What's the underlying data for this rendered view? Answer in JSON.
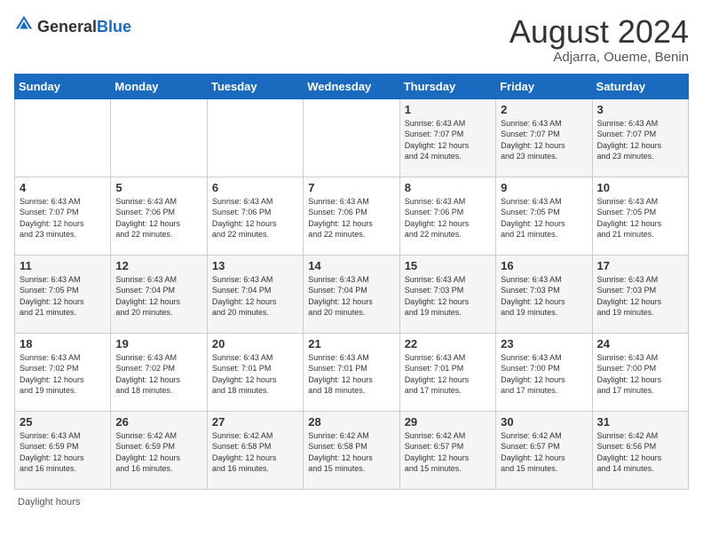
{
  "logo": {
    "text_general": "General",
    "text_blue": "Blue"
  },
  "calendar": {
    "title": "August 2024",
    "subtitle": "Adjarra, Oueme, Benin"
  },
  "days_of_week": [
    "Sunday",
    "Monday",
    "Tuesday",
    "Wednesday",
    "Thursday",
    "Friday",
    "Saturday"
  ],
  "footer": {
    "daylight_label": "Daylight hours"
  },
  "weeks": [
    [
      {
        "day": "",
        "info": ""
      },
      {
        "day": "",
        "info": ""
      },
      {
        "day": "",
        "info": ""
      },
      {
        "day": "",
        "info": ""
      },
      {
        "day": "1",
        "info": "Sunrise: 6:43 AM\nSunset: 7:07 PM\nDaylight: 12 hours\nand 24 minutes."
      },
      {
        "day": "2",
        "info": "Sunrise: 6:43 AM\nSunset: 7:07 PM\nDaylight: 12 hours\nand 23 minutes."
      },
      {
        "day": "3",
        "info": "Sunrise: 6:43 AM\nSunset: 7:07 PM\nDaylight: 12 hours\nand 23 minutes."
      }
    ],
    [
      {
        "day": "4",
        "info": "Sunrise: 6:43 AM\nSunset: 7:07 PM\nDaylight: 12 hours\nand 23 minutes."
      },
      {
        "day": "5",
        "info": "Sunrise: 6:43 AM\nSunset: 7:06 PM\nDaylight: 12 hours\nand 22 minutes."
      },
      {
        "day": "6",
        "info": "Sunrise: 6:43 AM\nSunset: 7:06 PM\nDaylight: 12 hours\nand 22 minutes."
      },
      {
        "day": "7",
        "info": "Sunrise: 6:43 AM\nSunset: 7:06 PM\nDaylight: 12 hours\nand 22 minutes."
      },
      {
        "day": "8",
        "info": "Sunrise: 6:43 AM\nSunset: 7:06 PM\nDaylight: 12 hours\nand 22 minutes."
      },
      {
        "day": "9",
        "info": "Sunrise: 6:43 AM\nSunset: 7:05 PM\nDaylight: 12 hours\nand 21 minutes."
      },
      {
        "day": "10",
        "info": "Sunrise: 6:43 AM\nSunset: 7:05 PM\nDaylight: 12 hours\nand 21 minutes."
      }
    ],
    [
      {
        "day": "11",
        "info": "Sunrise: 6:43 AM\nSunset: 7:05 PM\nDaylight: 12 hours\nand 21 minutes."
      },
      {
        "day": "12",
        "info": "Sunrise: 6:43 AM\nSunset: 7:04 PM\nDaylight: 12 hours\nand 20 minutes."
      },
      {
        "day": "13",
        "info": "Sunrise: 6:43 AM\nSunset: 7:04 PM\nDaylight: 12 hours\nand 20 minutes."
      },
      {
        "day": "14",
        "info": "Sunrise: 6:43 AM\nSunset: 7:04 PM\nDaylight: 12 hours\nand 20 minutes."
      },
      {
        "day": "15",
        "info": "Sunrise: 6:43 AM\nSunset: 7:03 PM\nDaylight: 12 hours\nand 19 minutes."
      },
      {
        "day": "16",
        "info": "Sunrise: 6:43 AM\nSunset: 7:03 PM\nDaylight: 12 hours\nand 19 minutes."
      },
      {
        "day": "17",
        "info": "Sunrise: 6:43 AM\nSunset: 7:03 PM\nDaylight: 12 hours\nand 19 minutes."
      }
    ],
    [
      {
        "day": "18",
        "info": "Sunrise: 6:43 AM\nSunset: 7:02 PM\nDaylight: 12 hours\nand 19 minutes."
      },
      {
        "day": "19",
        "info": "Sunrise: 6:43 AM\nSunset: 7:02 PM\nDaylight: 12 hours\nand 18 minutes."
      },
      {
        "day": "20",
        "info": "Sunrise: 6:43 AM\nSunset: 7:01 PM\nDaylight: 12 hours\nand 18 minutes."
      },
      {
        "day": "21",
        "info": "Sunrise: 6:43 AM\nSunset: 7:01 PM\nDaylight: 12 hours\nand 18 minutes."
      },
      {
        "day": "22",
        "info": "Sunrise: 6:43 AM\nSunset: 7:01 PM\nDaylight: 12 hours\nand 17 minutes."
      },
      {
        "day": "23",
        "info": "Sunrise: 6:43 AM\nSunset: 7:00 PM\nDaylight: 12 hours\nand 17 minutes."
      },
      {
        "day": "24",
        "info": "Sunrise: 6:43 AM\nSunset: 7:00 PM\nDaylight: 12 hours\nand 17 minutes."
      }
    ],
    [
      {
        "day": "25",
        "info": "Sunrise: 6:43 AM\nSunset: 6:59 PM\nDaylight: 12 hours\nand 16 minutes."
      },
      {
        "day": "26",
        "info": "Sunrise: 6:42 AM\nSunset: 6:59 PM\nDaylight: 12 hours\nand 16 minutes."
      },
      {
        "day": "27",
        "info": "Sunrise: 6:42 AM\nSunset: 6:58 PM\nDaylight: 12 hours\nand 16 minutes."
      },
      {
        "day": "28",
        "info": "Sunrise: 6:42 AM\nSunset: 6:58 PM\nDaylight: 12 hours\nand 15 minutes."
      },
      {
        "day": "29",
        "info": "Sunrise: 6:42 AM\nSunset: 6:57 PM\nDaylight: 12 hours\nand 15 minutes."
      },
      {
        "day": "30",
        "info": "Sunrise: 6:42 AM\nSunset: 6:57 PM\nDaylight: 12 hours\nand 15 minutes."
      },
      {
        "day": "31",
        "info": "Sunrise: 6:42 AM\nSunset: 6:56 PM\nDaylight: 12 hours\nand 14 minutes."
      }
    ]
  ]
}
